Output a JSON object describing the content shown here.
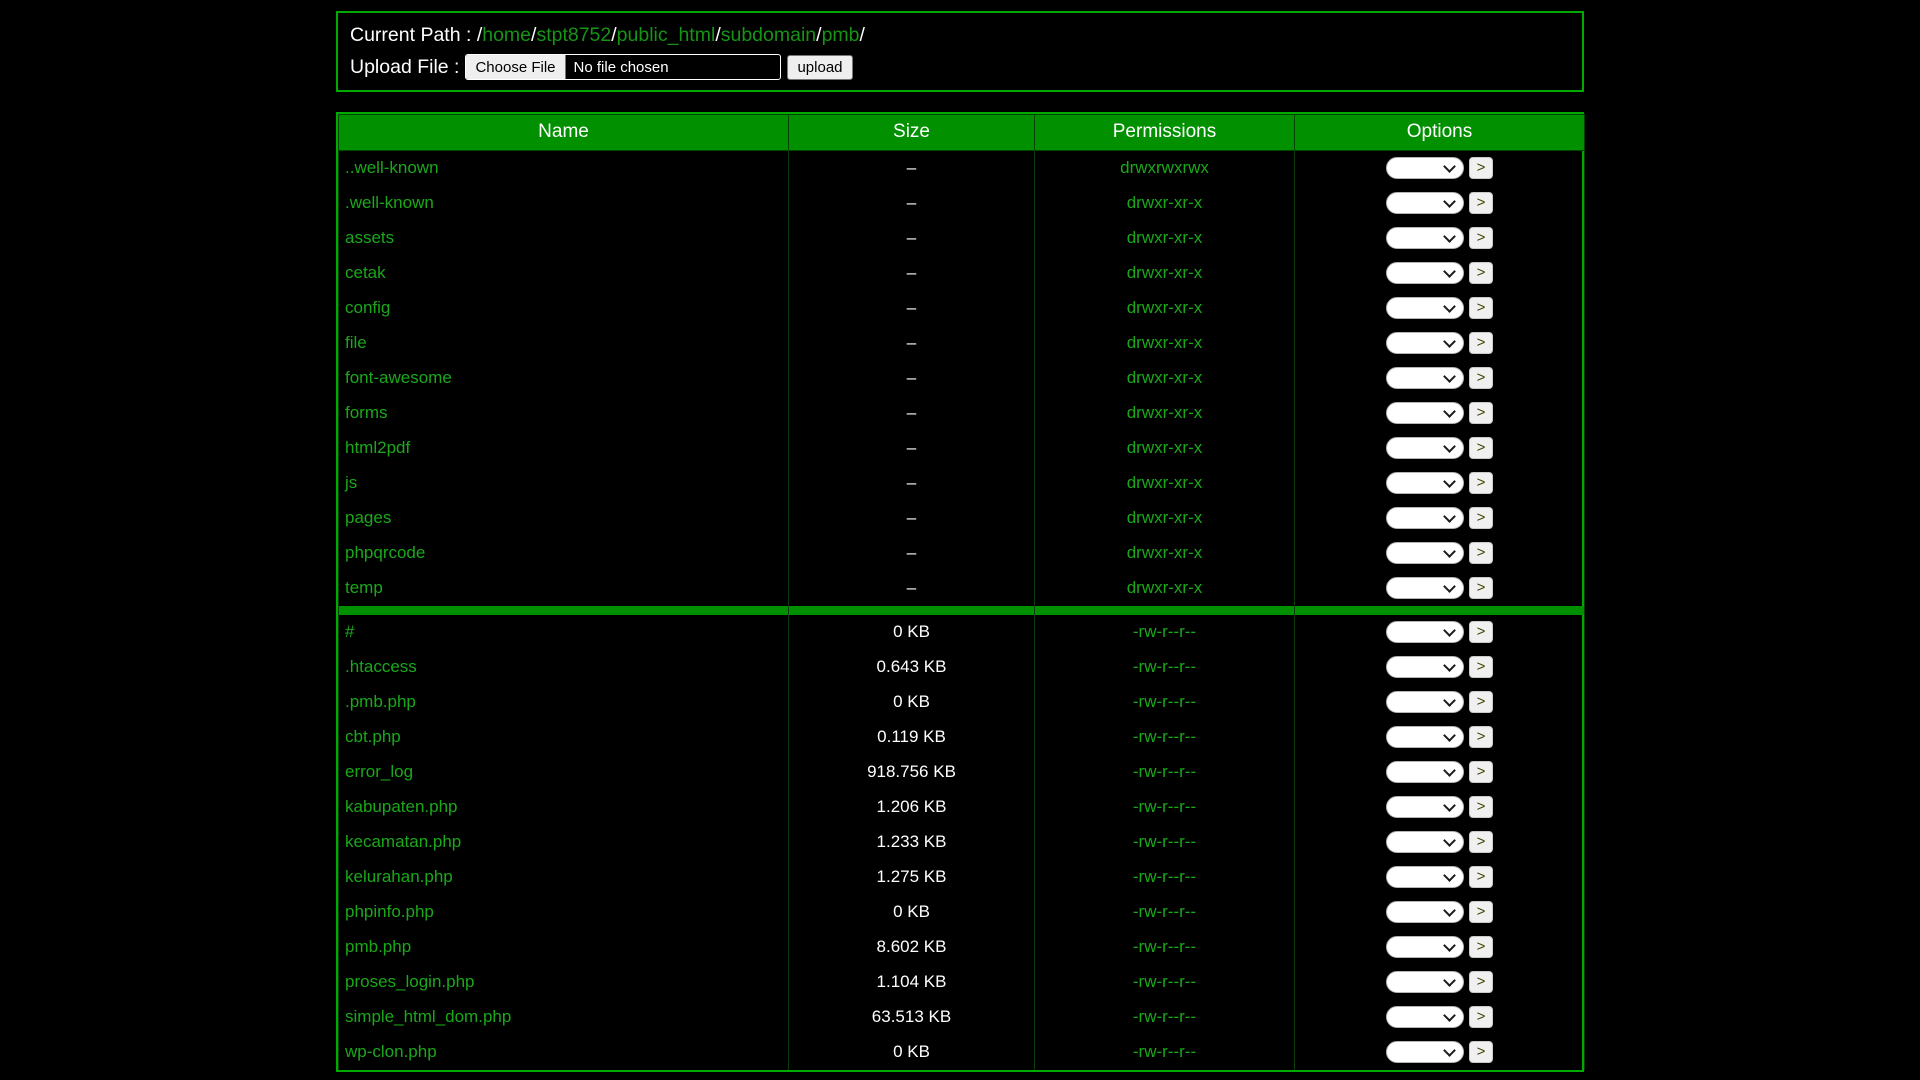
{
  "header": {
    "path_label": "Current Path :",
    "path_segments": [
      "home",
      "stpt8752",
      "public_html",
      "subdomain",
      "pmb"
    ],
    "upload_label": "Upload File :",
    "choose_file_label": "Choose File",
    "file_chosen_text": "No file chosen",
    "upload_button_label": "upload"
  },
  "table": {
    "columns": [
      "Name",
      "Size",
      "Permissions",
      "Options"
    ],
    "option_button_label": ">",
    "directories": [
      {
        "name": "..well-known",
        "size": "–",
        "permissions": "drwxrwxrwx"
      },
      {
        "name": ".well-known",
        "size": "–",
        "permissions": "drwxr-xr-x"
      },
      {
        "name": "assets",
        "size": "–",
        "permissions": "drwxr-xr-x"
      },
      {
        "name": "cetak",
        "size": "–",
        "permissions": "drwxr-xr-x"
      },
      {
        "name": "config",
        "size": "–",
        "permissions": "drwxr-xr-x"
      },
      {
        "name": "file",
        "size": "–",
        "permissions": "drwxr-xr-x"
      },
      {
        "name": "font-awesome",
        "size": "–",
        "permissions": "drwxr-xr-x"
      },
      {
        "name": "forms",
        "size": "–",
        "permissions": "drwxr-xr-x"
      },
      {
        "name": "html2pdf",
        "size": "–",
        "permissions": "drwxr-xr-x"
      },
      {
        "name": "js",
        "size": "–",
        "permissions": "drwxr-xr-x"
      },
      {
        "name": "pages",
        "size": "–",
        "permissions": "drwxr-xr-x"
      },
      {
        "name": "phpqrcode",
        "size": "–",
        "permissions": "drwxr-xr-x"
      },
      {
        "name": "temp",
        "size": "–",
        "permissions": "drwxr-xr-x"
      }
    ],
    "files": [
      {
        "name": "#",
        "size": "0 KB",
        "permissions": "-rw-r--r--"
      },
      {
        "name": ".htaccess",
        "size": "0.643 KB",
        "permissions": "-rw-r--r--"
      },
      {
        "name": ".pmb.php",
        "size": "0 KB",
        "permissions": "-rw-r--r--"
      },
      {
        "name": "cbt.php",
        "size": "0.119 KB",
        "permissions": "-rw-r--r--"
      },
      {
        "name": "error_log",
        "size": "918.756 KB",
        "permissions": "-rw-r--r--"
      },
      {
        "name": "kabupaten.php",
        "size": "1.206 KB",
        "permissions": "-rw-r--r--"
      },
      {
        "name": "kecamatan.php",
        "size": "1.233 KB",
        "permissions": "-rw-r--r--"
      },
      {
        "name": "kelurahan.php",
        "size": "1.275 KB",
        "permissions": "-rw-r--r--"
      },
      {
        "name": "phpinfo.php",
        "size": "0 KB",
        "permissions": "-rw-r--r--"
      },
      {
        "name": "pmb.php",
        "size": "8.602 KB",
        "permissions": "-rw-r--r--"
      },
      {
        "name": "proses_login.php",
        "size": "1.104 KB",
        "permissions": "-rw-r--r--"
      },
      {
        "name": "simple_html_dom.php",
        "size": "63.513 KB",
        "permissions": "-rw-r--r--"
      },
      {
        "name": "wp-clon.php",
        "size": "0 KB",
        "permissions": "-rw-r--r--"
      }
    ]
  },
  "colors": {
    "background": "#000000",
    "border_green": "#00aa00",
    "header_green": "#009000",
    "link_green": "#1aa81a",
    "text_white": "#ffffff"
  }
}
